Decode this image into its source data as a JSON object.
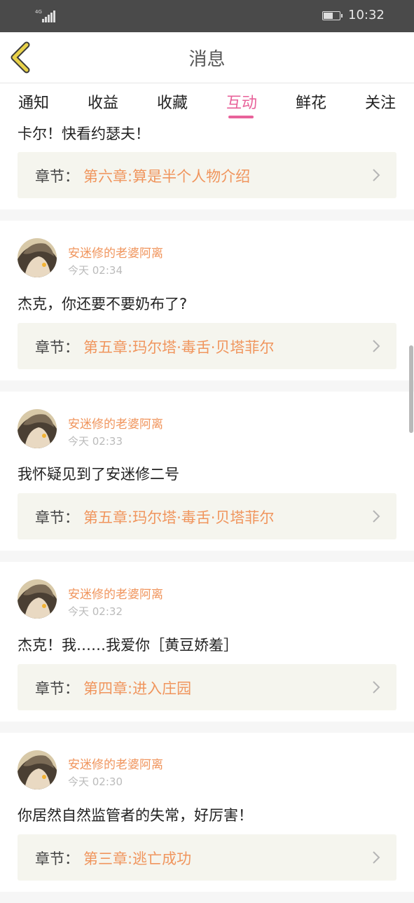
{
  "status_bar": {
    "network": "4G",
    "time": "10:32"
  },
  "header": {
    "title": "消息"
  },
  "tabs": [
    {
      "label": "通知"
    },
    {
      "label": "收益"
    },
    {
      "label": "收藏"
    },
    {
      "label": "互动",
      "active": true
    },
    {
      "label": "鲜花"
    },
    {
      "label": "关注"
    }
  ],
  "partial_item": {
    "comment": "卡尔！快看约瑟夫！",
    "chapter_label": "章节：",
    "chapter": "第六章:算是半个人物介绍"
  },
  "items": [
    {
      "user": "安迷修的老婆阿离",
      "time": "今天 02:34",
      "comment": "杰克，你还要不要奶布了?",
      "chapter_label": "章节：",
      "chapter": "第五章:玛尔塔·毒舌·贝塔菲尔"
    },
    {
      "user": "安迷修的老婆阿离",
      "time": "今天 02:33",
      "comment": "我怀疑见到了安迷修二号",
      "chapter_label": "章节：",
      "chapter": "第五章:玛尔塔·毒舌·贝塔菲尔"
    },
    {
      "user": "安迷修的老婆阿离",
      "time": "今天 02:32",
      "comment": "杰克！我……我爱你［黄豆娇羞］",
      "chapter_label": "章节：",
      "chapter": "第四章:进入庄园"
    },
    {
      "user": "安迷修的老婆阿离",
      "time": "今天 02:30",
      "comment": "你居然自然监管者的失常，好厉害！",
      "chapter_label": "章节：",
      "chapter": "第三章:逃亡成功"
    }
  ],
  "colors": {
    "accent": "#e8629a",
    "link": "#f0955d",
    "card_bg": "#f5f5ee",
    "back_arrow": "#e9d24a"
  },
  "icons": [
    "back-arrow-icon",
    "chevron-right-icon",
    "signal-icon",
    "battery-icon"
  ]
}
